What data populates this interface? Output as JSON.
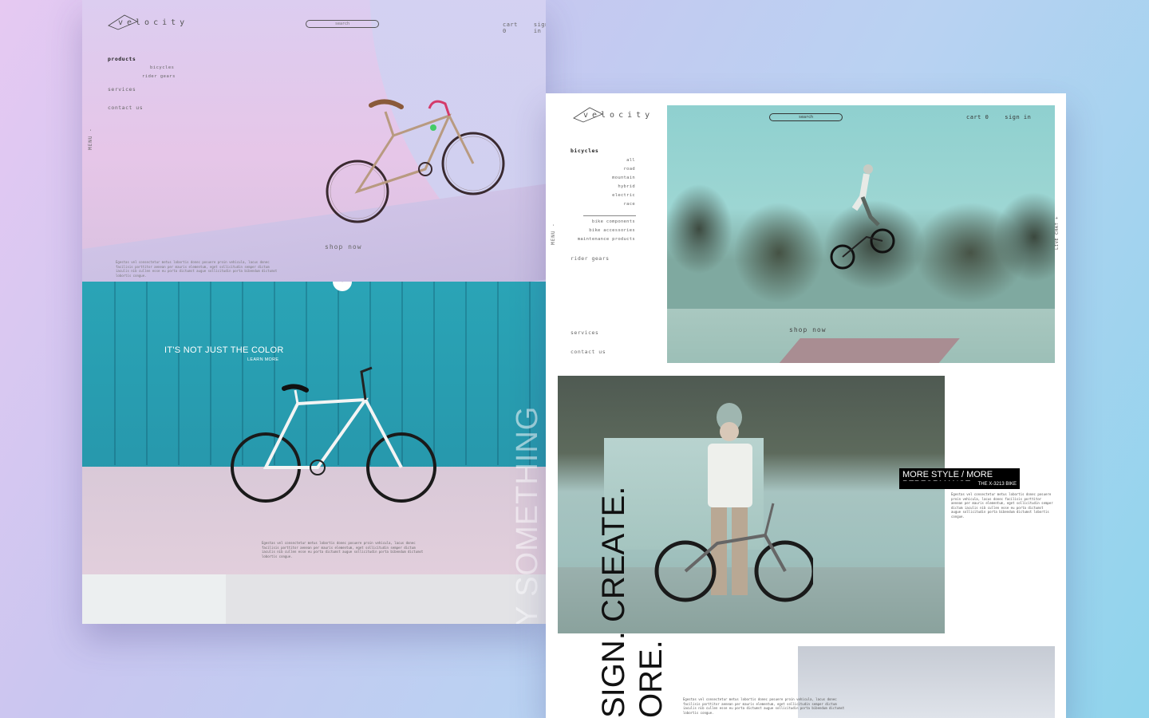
{
  "brand": {
    "name": "velocity"
  },
  "left_page": {
    "search_placeholder": "search",
    "cart": "cart 0",
    "sign_in": "sign in",
    "nav": {
      "products": "products",
      "bicycles": "bicycles",
      "rider_gears": "rider gears",
      "services": "services",
      "contact_us": "contact us"
    },
    "menu_label": "MENU -",
    "shop_now": "shop now",
    "body_text": "Egestas vel consectetur metus lobortis donec posuere proin vehicula, lacus donec facilisis porttitor aenean per mauris elementum, eget sollicitudin semper dictum iaculis nib cullen esse eu porta dictumst augue sollicitudin porta bibendum dictumst lobortis congue.",
    "tagline": "IT'S NOT JUST THE COLOR",
    "learn_more": "LEARN MORE",
    "body_text_2": "Egestas vel consectetur metus lobortis donec posuere proin vehicula, lacus donec facilisis porttitor aenean per mauris elementum, eget sollicitudin semper dictum iaculis nib cullen esse eu porta dictumst augue sollicitudin porta bibendum dictumst lobortis congue.",
    "vertical_text": "Y SOMETHING"
  },
  "right_page": {
    "search_placeholder": "search",
    "cart": "cart 0",
    "sign_in": "sign in",
    "nav": {
      "bicycles": "bicycles",
      "sub": [
        "all",
        "road",
        "mountain",
        "hybrid",
        "electric",
        "race"
      ],
      "extra": [
        "bike components",
        "bike accessories",
        "maintenance products"
      ],
      "rider_gears": "rider gears",
      "services": "services",
      "contact_us": "contact us"
    },
    "menu_label": "MENU -",
    "live_chat": "LIVE CHAT +",
    "shop_now": "shop now",
    "promo_title": "MORE STYLE / MORE PERFORMANCE",
    "promo_sub": "THE X-3213 BIKE",
    "promo_text": "Egestas vel consectetur metus lobortis donec posuere proin vehicula, lacus donec facilisis porttitor aenean per mauris elementum, eget sollicitudin semper dictum iaculis nib cullen esse eu porta dictumst augue sollicitudin porta bibendum dictumst lobortis congue.",
    "vertical_1": "SIGN. CREATE.",
    "vertical_2": "ORE.",
    "bottom_text": "Egestas vel consectetur metus lobortis donec posuere proin vehicula, lacus donec facilisis porttitor aenean per mauris elementum, eget sollicitudin semper dictum iaculis nib cullen esse eu porta dictumst augue sollicitudin porta bibendum dictumst lobortis congue."
  }
}
